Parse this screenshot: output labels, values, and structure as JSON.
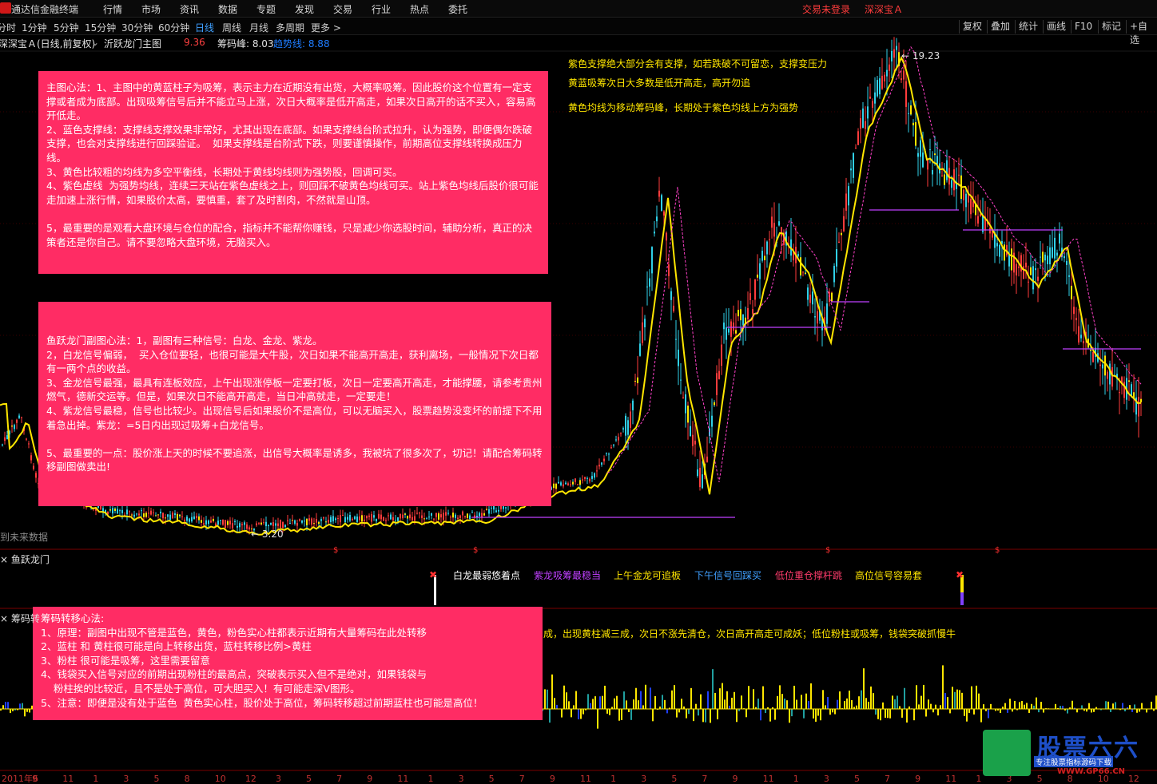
{
  "app": {
    "name": "通达信金融终端"
  },
  "menu": [
    "行情",
    "市场",
    "资讯",
    "数据",
    "专题",
    "发现",
    "交易",
    "行业",
    "热点",
    "委托"
  ],
  "login": {
    "status": "交易未登录",
    "stock": "深深宝Ａ"
  },
  "periods": [
    "分时",
    "1分钟",
    "5分钟",
    "15分钟",
    "30分钟",
    "60分钟",
    "日线",
    "周线",
    "月线",
    "多周期",
    "更多 >"
  ],
  "active_period": "日线",
  "toolbar": [
    "复权",
    "叠加",
    "统计",
    "画线",
    "F10",
    "标记",
    "+自选"
  ],
  "indicator": {
    "stock": "深深宝Ａ(日线,前复权)",
    "formula": "沂跃龙门主图",
    "val1": "9.36",
    "chip_label": "筹码峰: 8.03",
    "trend_label": "趋势线: 8.88"
  },
  "prices": {
    "high": "19.23",
    "low": "3.20"
  },
  "future_data_label": "到未来数据",
  "notes": [
    "紫色支撑绝大部分会有支撑，如若跌破不可留恋，支撑变压力",
    "黄蓝吸筹次日大多数是低开高走，高开勿追",
    "黄色均线为移动筹码峰，长期处于紫色均线上方为强势"
  ],
  "panel1": [
    "主图心法：1、主图中的黄蓝柱子为吸筹，表示主力在近期没有出货，大概率吸筹。因此股价这个位置有一定支撑或者成为底部。出现吸筹信号后并不能立马上涨，次日大概率是低开高走，如果次日高开的话不买入，容易高开低走。",
    "2、蓝色支撑线：支撑线支撑效果非常好，尤其出现在底部。如果支撑线台阶式拉升，认为强势，即便偶尔跌破支撑，也会对支撑线进行回踩验证。  如果支撑线是台阶式下跌，则要谨慎操作，前期高位支撑线转换成压力线。",
    "3、黄色比较粗的均线为多空平衡线，长期处于黄线均线则为强势股，回调可买。",
    "4、紫色虚线  为强势均线，连续三天站在紫色虚线之上，则回踩不破黄色均线可买。站上紫色均线后股价很可能走加速上涨行情，如果股价太高，要慎重，套了及时割肉，不然就是山顶。",
    "",
    "5，最重要的是观看大盘环境与仓位的配合，指标并不能帮你赚钱，只是减少你选股时间，辅助分析，真正的决策者还是你自己。请不要忽略大盘环境，无脑买入。"
  ],
  "panel2": [
    "鱼跃龙门副图心法：1，副图有三种信号：白龙、金龙、紫龙。",
    "2，白龙信号偏弱，  买入仓位要轻，也很可能是大牛股，次日如果不能高开高走，获利离场，一般情况下次日都有一两个点的收益。",
    "3、金龙信号最强，最具有连板效应，上午出现涨停板一定要打板，次日一定要高开高走，才能撑腰，请参考贵州燃气，德新交运等。但是，如果次日不能高开高走，当日冲高就走，一定要走！",
    "4、紫龙信号最稳，信号也比较少。出现信号后如果股价不是高位，可以无脑买入，股票趋势没变坏的前提下不用着急出掉。紫龙：=5日内出现过吸筹+白龙信号。",
    "",
    "5、最重要的一点：股价涨上天的时候不要追涨，出信号大概率是诱多，我被坑了很多次了，切记！请配合筹码转移副图做卖出!"
  ],
  "panel3": [
    "筹码转移心法:",
    "1、原理：副图中出现不管是蓝色，黄色，粉色实心柱都表示近期有大量筹码在此处转移",
    "2、蓝柱 和 黄柱很可能是向上转移出货，蓝柱转移比例>黄柱",
    "3、粉柱 很可能是吸筹，这里需要留意",
    "4、钱袋买入信号对应的前期出现粉柱的最高点，突破表示买入但不是绝对，如果钱袋与",
    "    粉柱挨的比较近，且不是处于高位，可大胆买入！有可能走深V图形。",
    "5、注意：即便是没有处于蓝色  黄色实心柱，股价处于高位，筹码转移超过前期蓝柱也可能是高位！"
  ],
  "sub1": {
    "title": "鱼跃龙门",
    "legend": [
      {
        "text": "白龙最弱悠着点",
        "color": "#ffffff"
      },
      {
        "text": "紫龙吸筹最稳当",
        "color": "#c040ff"
      },
      {
        "text": "上午金龙可追板",
        "color": "#ffe600"
      },
      {
        "text": "下午信号回踩买",
        "color": "#40a0ff"
      },
      {
        "text": "低位重仓撑杆跳",
        "color": "#ff3c6c"
      },
      {
        "text": "高位信号容易套",
        "color": "#ffe600"
      }
    ]
  },
  "sub2": {
    "title": "筹码转",
    "tail_note": "成，出现黄柱减三成，次日不涨先清仓，次日高开高走可成妖；低位粉柱或吸筹，钱袋突破抓慢牛"
  },
  "xaxis": [
    "2011年6",
    "9",
    "11",
    "1",
    "3",
    "5",
    "8",
    "10",
    "12",
    "3",
    "5",
    "7",
    "9",
    "11",
    "1",
    "3",
    "5",
    "7",
    "9",
    "11",
    "1",
    "3",
    "5",
    "7",
    "9",
    "11",
    "1",
    "3",
    "5",
    "7",
    "9",
    "11",
    "1",
    "3",
    "5",
    "8",
    "10",
    "12"
  ],
  "watermark": {
    "brand": "股票六六",
    "slogan": "专注股票指标源码下载",
    "url": "WWW.GP66.CN"
  },
  "colors": {
    "up": "#ff3c3c",
    "down": "#30d0e8",
    "ma": "#ffe600",
    "trend": "#ff40c8",
    "support": "#c040ff",
    "panel": "#ff2c64"
  }
}
